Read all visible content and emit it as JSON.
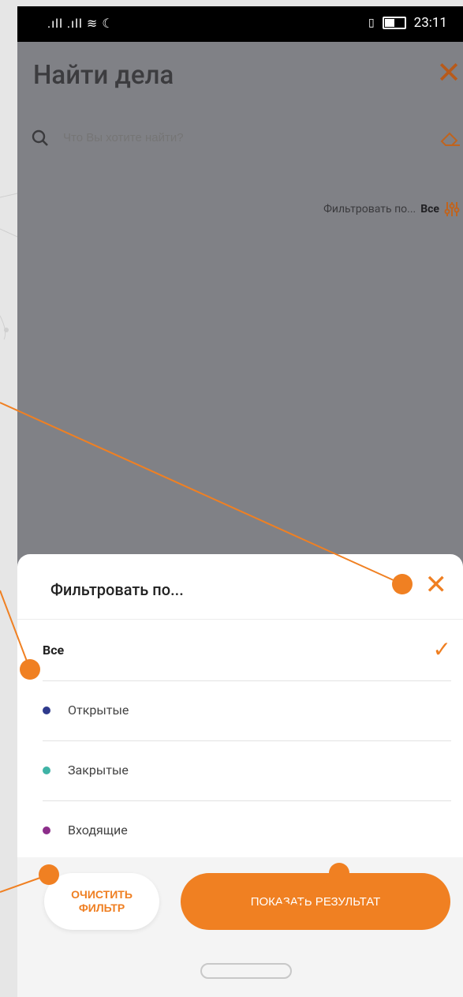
{
  "status_bar": {
    "signal_icons": ".ıll .ıll ≋ ☾",
    "time": "23:11"
  },
  "header": {
    "title": "Найти дела",
    "close_icon": "close-icon"
  },
  "search": {
    "placeholder": "Что Вы хотите найти?",
    "icon": "search-icon",
    "clear_icon": "eraser-icon"
  },
  "filter_bar": {
    "prefix": "Фильтровать по...",
    "value": "Все",
    "icon": "sliders-icon"
  },
  "sheet": {
    "title": "Фильтровать по...",
    "options": [
      {
        "label": "Все",
        "selected": true
      },
      {
        "label": "Открытые",
        "dot_color": "#2e3a8c"
      },
      {
        "label": "Закрытые",
        "dot_color": "#3fb3a6"
      },
      {
        "label": "Входящие",
        "dot_color": "#8c2e8a"
      }
    ],
    "clear_button": "ОЧИСТИТЬ ФИЛЬТР",
    "show_button": "ПОКАЗАТЬ РЕЗУЛЬТАТ"
  },
  "colors": {
    "accent": "#f08022",
    "dim_background": "#808186",
    "annotation": "#f08022"
  }
}
